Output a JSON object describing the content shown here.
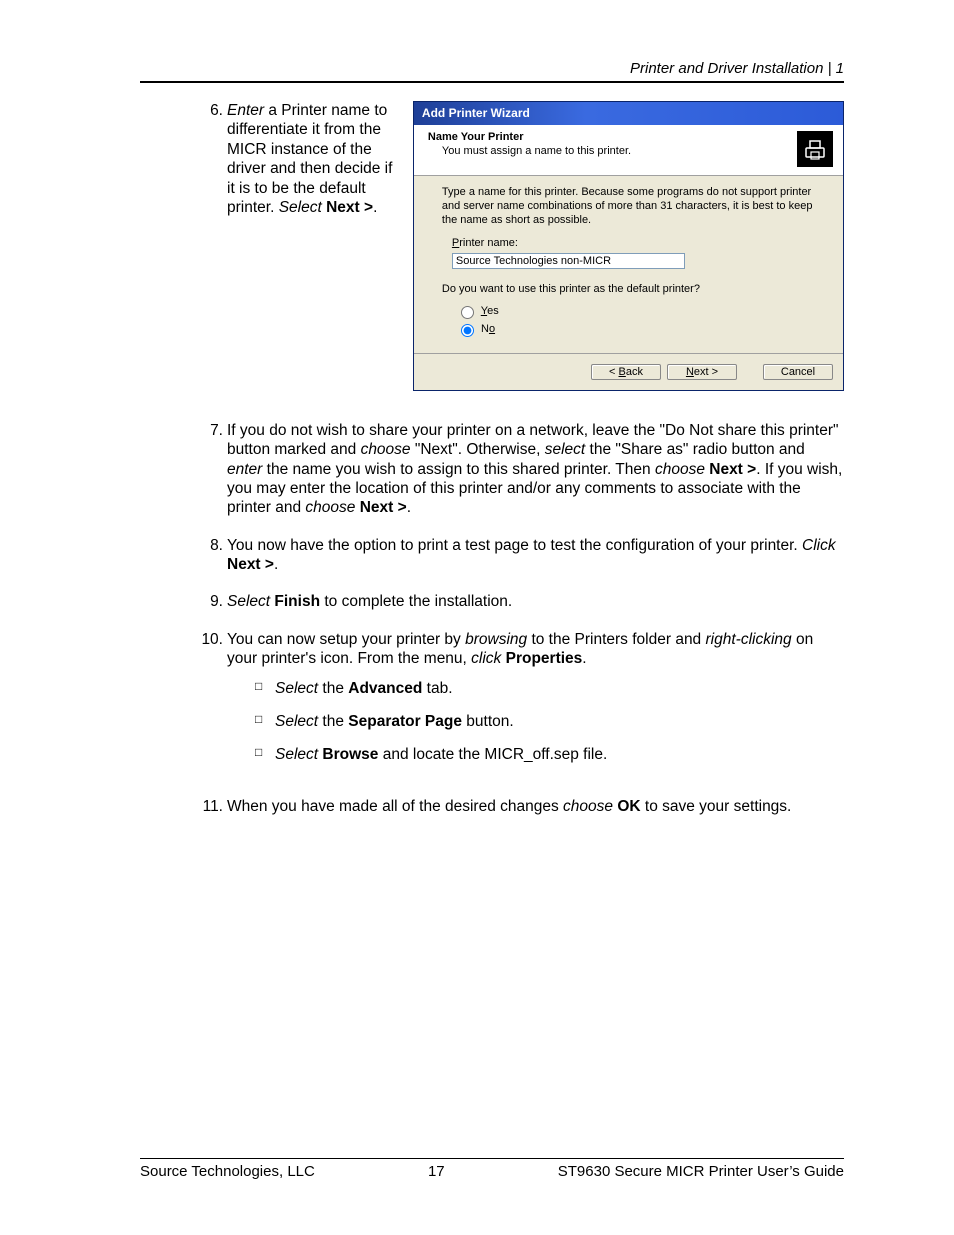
{
  "header": {
    "right": "Printer and Driver Installation  |  1"
  },
  "step6": {
    "num": "6.",
    "text_html": "<i>Enter</i> a Printer name to differentiate it from the MICR instance of the driver and then decide if it is to be the default printer. <i>Select</i> <b>Next &gt;</b>."
  },
  "wizard": {
    "title": "Add Printer Wizard",
    "header_title": "Name Your Printer",
    "header_sub": "You must assign a name to this printer.",
    "desc": "Type a name for this printer. Because some programs do not support printer and server name combinations of more than 31 characters, it is best to keep the name as short as possible.",
    "field_label_html": "<span class='ul'>P</span>rinter name:",
    "field_value": "Source Technologies non-MICR",
    "question": "Do you want to use this printer as the default printer?",
    "radio_yes_html": "<span class='ul'>Y</span>es",
    "radio_no_html": "N<span class='ul'>o</span>",
    "btn_back_html": "&lt; <span class='ul'>B</span>ack",
    "btn_next_html": "<span class='ul'>N</span>ext &gt;",
    "btn_cancel": "Cancel"
  },
  "step7": {
    "num": "7.",
    "text_html": "If you do not wish to share your printer on a network, leave the \"Do Not share this printer\" button marked and <i>choose</i> \"Next\". Otherwise, <i>select</i> the \"Share as\" radio button and <i>enter</i> the name you wish to assign to this shared printer. Then <i>choose</i> <b>Next &gt;</b>. If you wish, you may enter the location of this printer and/or any comments to associate with the printer and <i>choose</i> <b>Next &gt;</b>."
  },
  "step8": {
    "num": "8.",
    "text_html": "You now have the option to print a test page to test the configuration of your printer. <i>Click</i> <b>Next &gt;</b>."
  },
  "step9": {
    "num": "9.",
    "text_html": "<i>Select</i> <b>Finish</b> to complete the installation."
  },
  "step10": {
    "num": "10.",
    "text_html": "You can now setup your printer by <i>browsing</i> to the Printers folder and <i>right-clicking</i> on your printer's icon.  From the menu, <i>click</i> <b>Properties</b>.",
    "sub": [
      {
        "html": "<i>Select</i> the <b>Advanced</b> tab."
      },
      {
        "html": "<i>Select</i> the <b>Separator Page</b> button."
      },
      {
        "html": "<i>Select</i> <b>Browse</b> and locate the MICR_off.sep file."
      }
    ]
  },
  "step11": {
    "num": "11.",
    "text_html": "When you have made all of the desired changes <i>choose</i> <b>OK</b> to save your settings."
  },
  "footer": {
    "left": "Source Technologies, LLC",
    "center": "17",
    "right": "ST9630 Secure MICR Printer User’s Guide"
  }
}
